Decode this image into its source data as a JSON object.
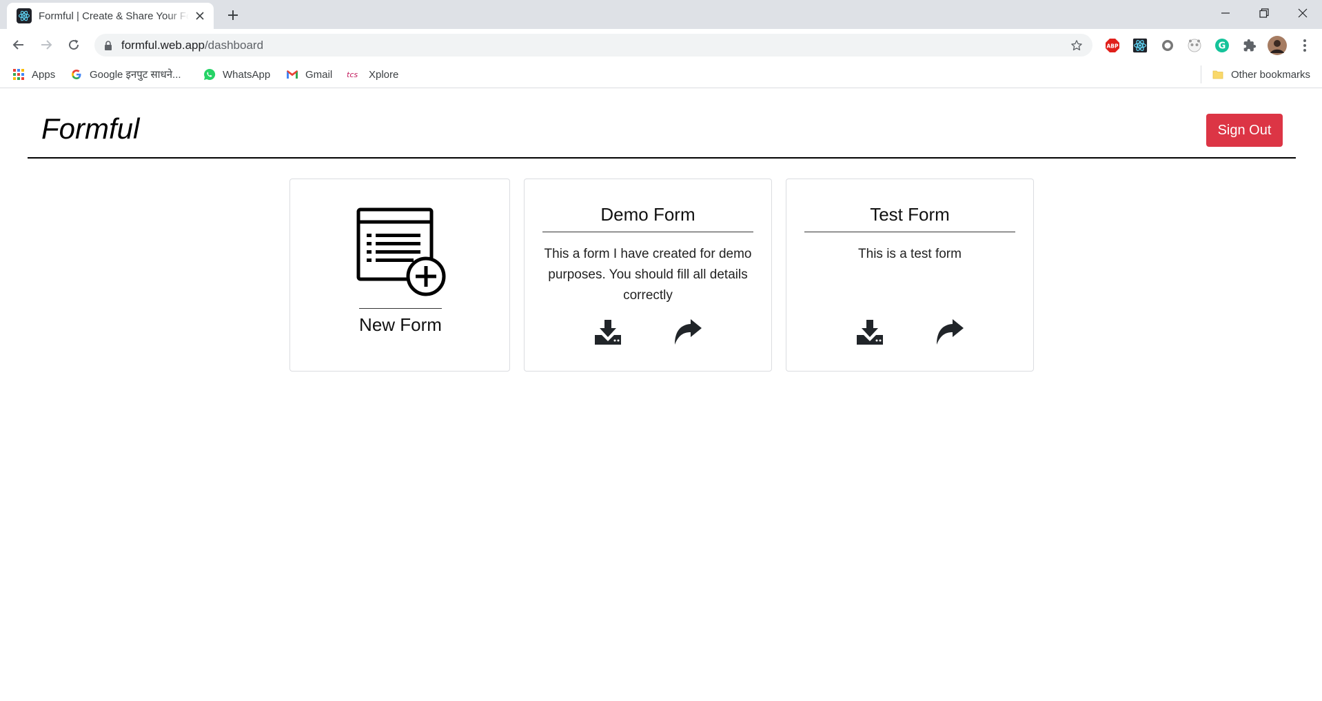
{
  "browser": {
    "tab_title": "Formful | Create & Share Your Forms",
    "url_host": "formful.web.app",
    "url_path": "/dashboard",
    "bookmarks": [
      {
        "label": "Apps",
        "icon": "apps-grid-icon"
      },
      {
        "label": "Google इनपुट साधने...",
        "icon": "google-icon"
      },
      {
        "label": "WhatsApp",
        "icon": "whatsapp-icon"
      },
      {
        "label": "Gmail",
        "icon": "gmail-icon"
      },
      {
        "label": "Xplore",
        "icon": "tcs-icon"
      }
    ],
    "other_bookmarks": "Other bookmarks",
    "extensions": [
      "adblock-plus-icon",
      "react-devtools-icon",
      "circle-extension-icon",
      "panda-extension-icon",
      "grammarly-icon",
      "extensions-puzzle-icon",
      "profile-avatar"
    ],
    "colors": {
      "tabstrip": "#dee1e6",
      "omnibox": "#f1f3f4"
    }
  },
  "app": {
    "brand": "Formful",
    "signout_label": "Sign Out",
    "colors": {
      "signout": "#dc3545"
    }
  },
  "cards": {
    "new_form": {
      "label": "New Form",
      "icon": "new-form-icon"
    },
    "forms": [
      {
        "title": "Demo Form",
        "description": "This a form I have created for demo purposes. You should fill all details correctly",
        "actions": [
          "download-icon",
          "share-icon"
        ]
      },
      {
        "title": "Test Form",
        "description": "This is a test form",
        "actions": [
          "download-icon",
          "share-icon"
        ]
      }
    ]
  }
}
